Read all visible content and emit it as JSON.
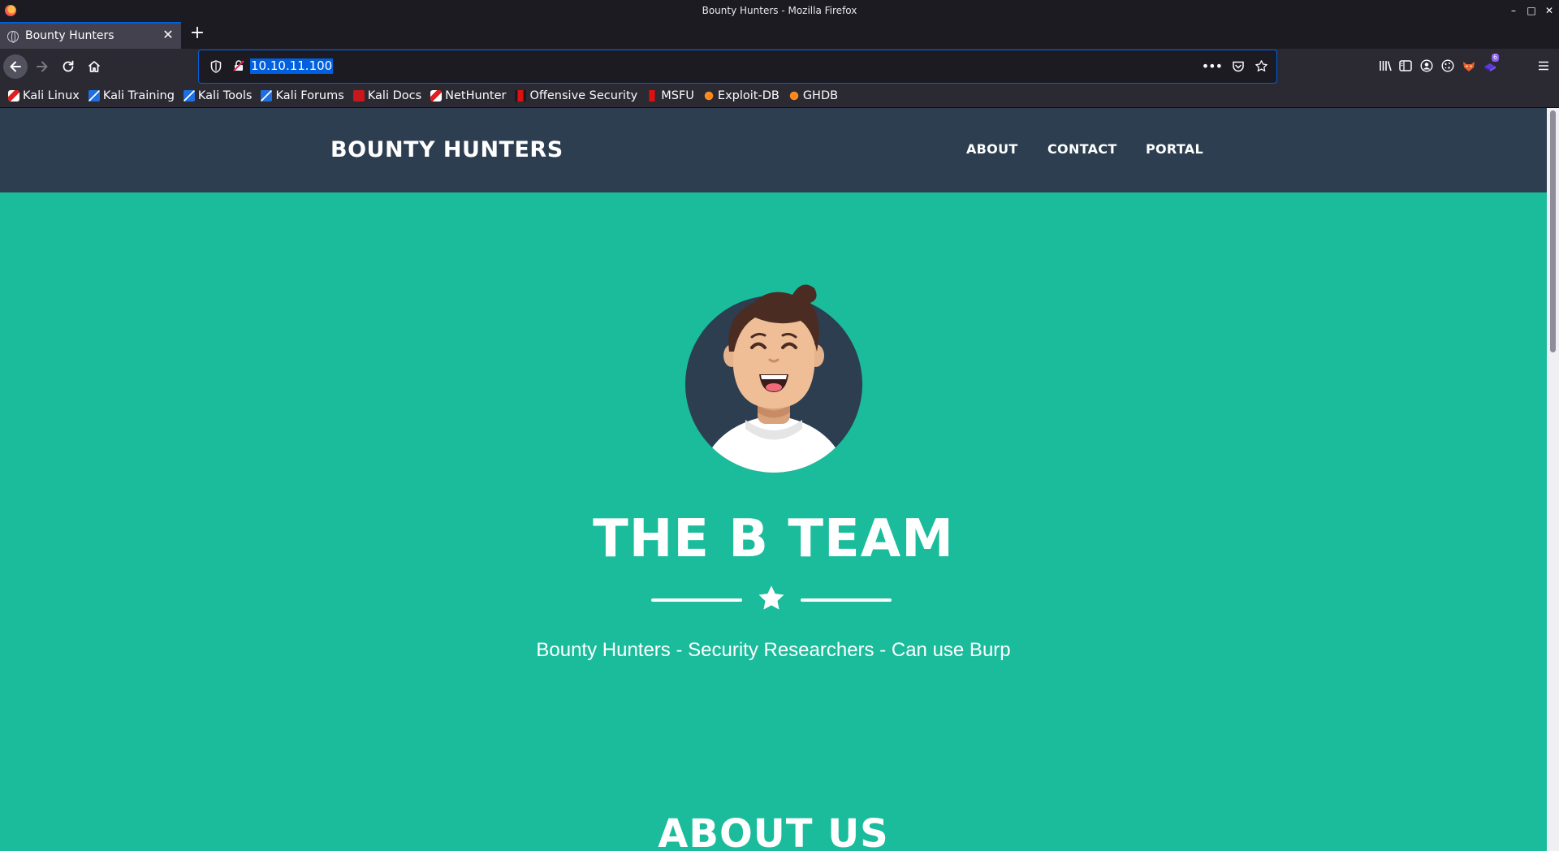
{
  "window": {
    "title": "Bounty Hunters - Mozilla Firefox"
  },
  "tabs": [
    {
      "label": "Bounty Hunters"
    }
  ],
  "urlbar": {
    "url": "10.10.11.100"
  },
  "bookmarks": [
    {
      "label": "Kali Linux",
      "icon": "kali-icon"
    },
    {
      "label": "Kali Training",
      "icon": "kali-training-icon"
    },
    {
      "label": "Kali Tools",
      "icon": "kali-tools-icon"
    },
    {
      "label": "Kali Forums",
      "icon": "kali-forums-icon"
    },
    {
      "label": "Kali Docs",
      "icon": "kali-docs-icon"
    },
    {
      "label": "NetHunter",
      "icon": "nethunter-icon"
    },
    {
      "label": "Offensive Security",
      "icon": "offsec-icon"
    },
    {
      "label": "MSFU",
      "icon": "msfu-icon"
    },
    {
      "label": "Exploit-DB",
      "icon": "exploitdb-icon"
    },
    {
      "label": "GHDB",
      "icon": "ghdb-icon"
    }
  ],
  "toolbar": {
    "extension_badge": "6"
  },
  "site": {
    "brand": "BOUNTY HUNTERS",
    "nav": {
      "about": "ABOUT",
      "contact": "CONTACT",
      "portal": "PORTAL"
    },
    "masthead": {
      "title": "THE B TEAM",
      "subtitle": "Bounty Hunters - Security Researchers - Can use Burp"
    },
    "about_heading": "ABOUT US"
  },
  "colors": {
    "header_bg": "#2c3e50",
    "page_bg": "#1abc9c",
    "url_selection": "#0060df"
  }
}
